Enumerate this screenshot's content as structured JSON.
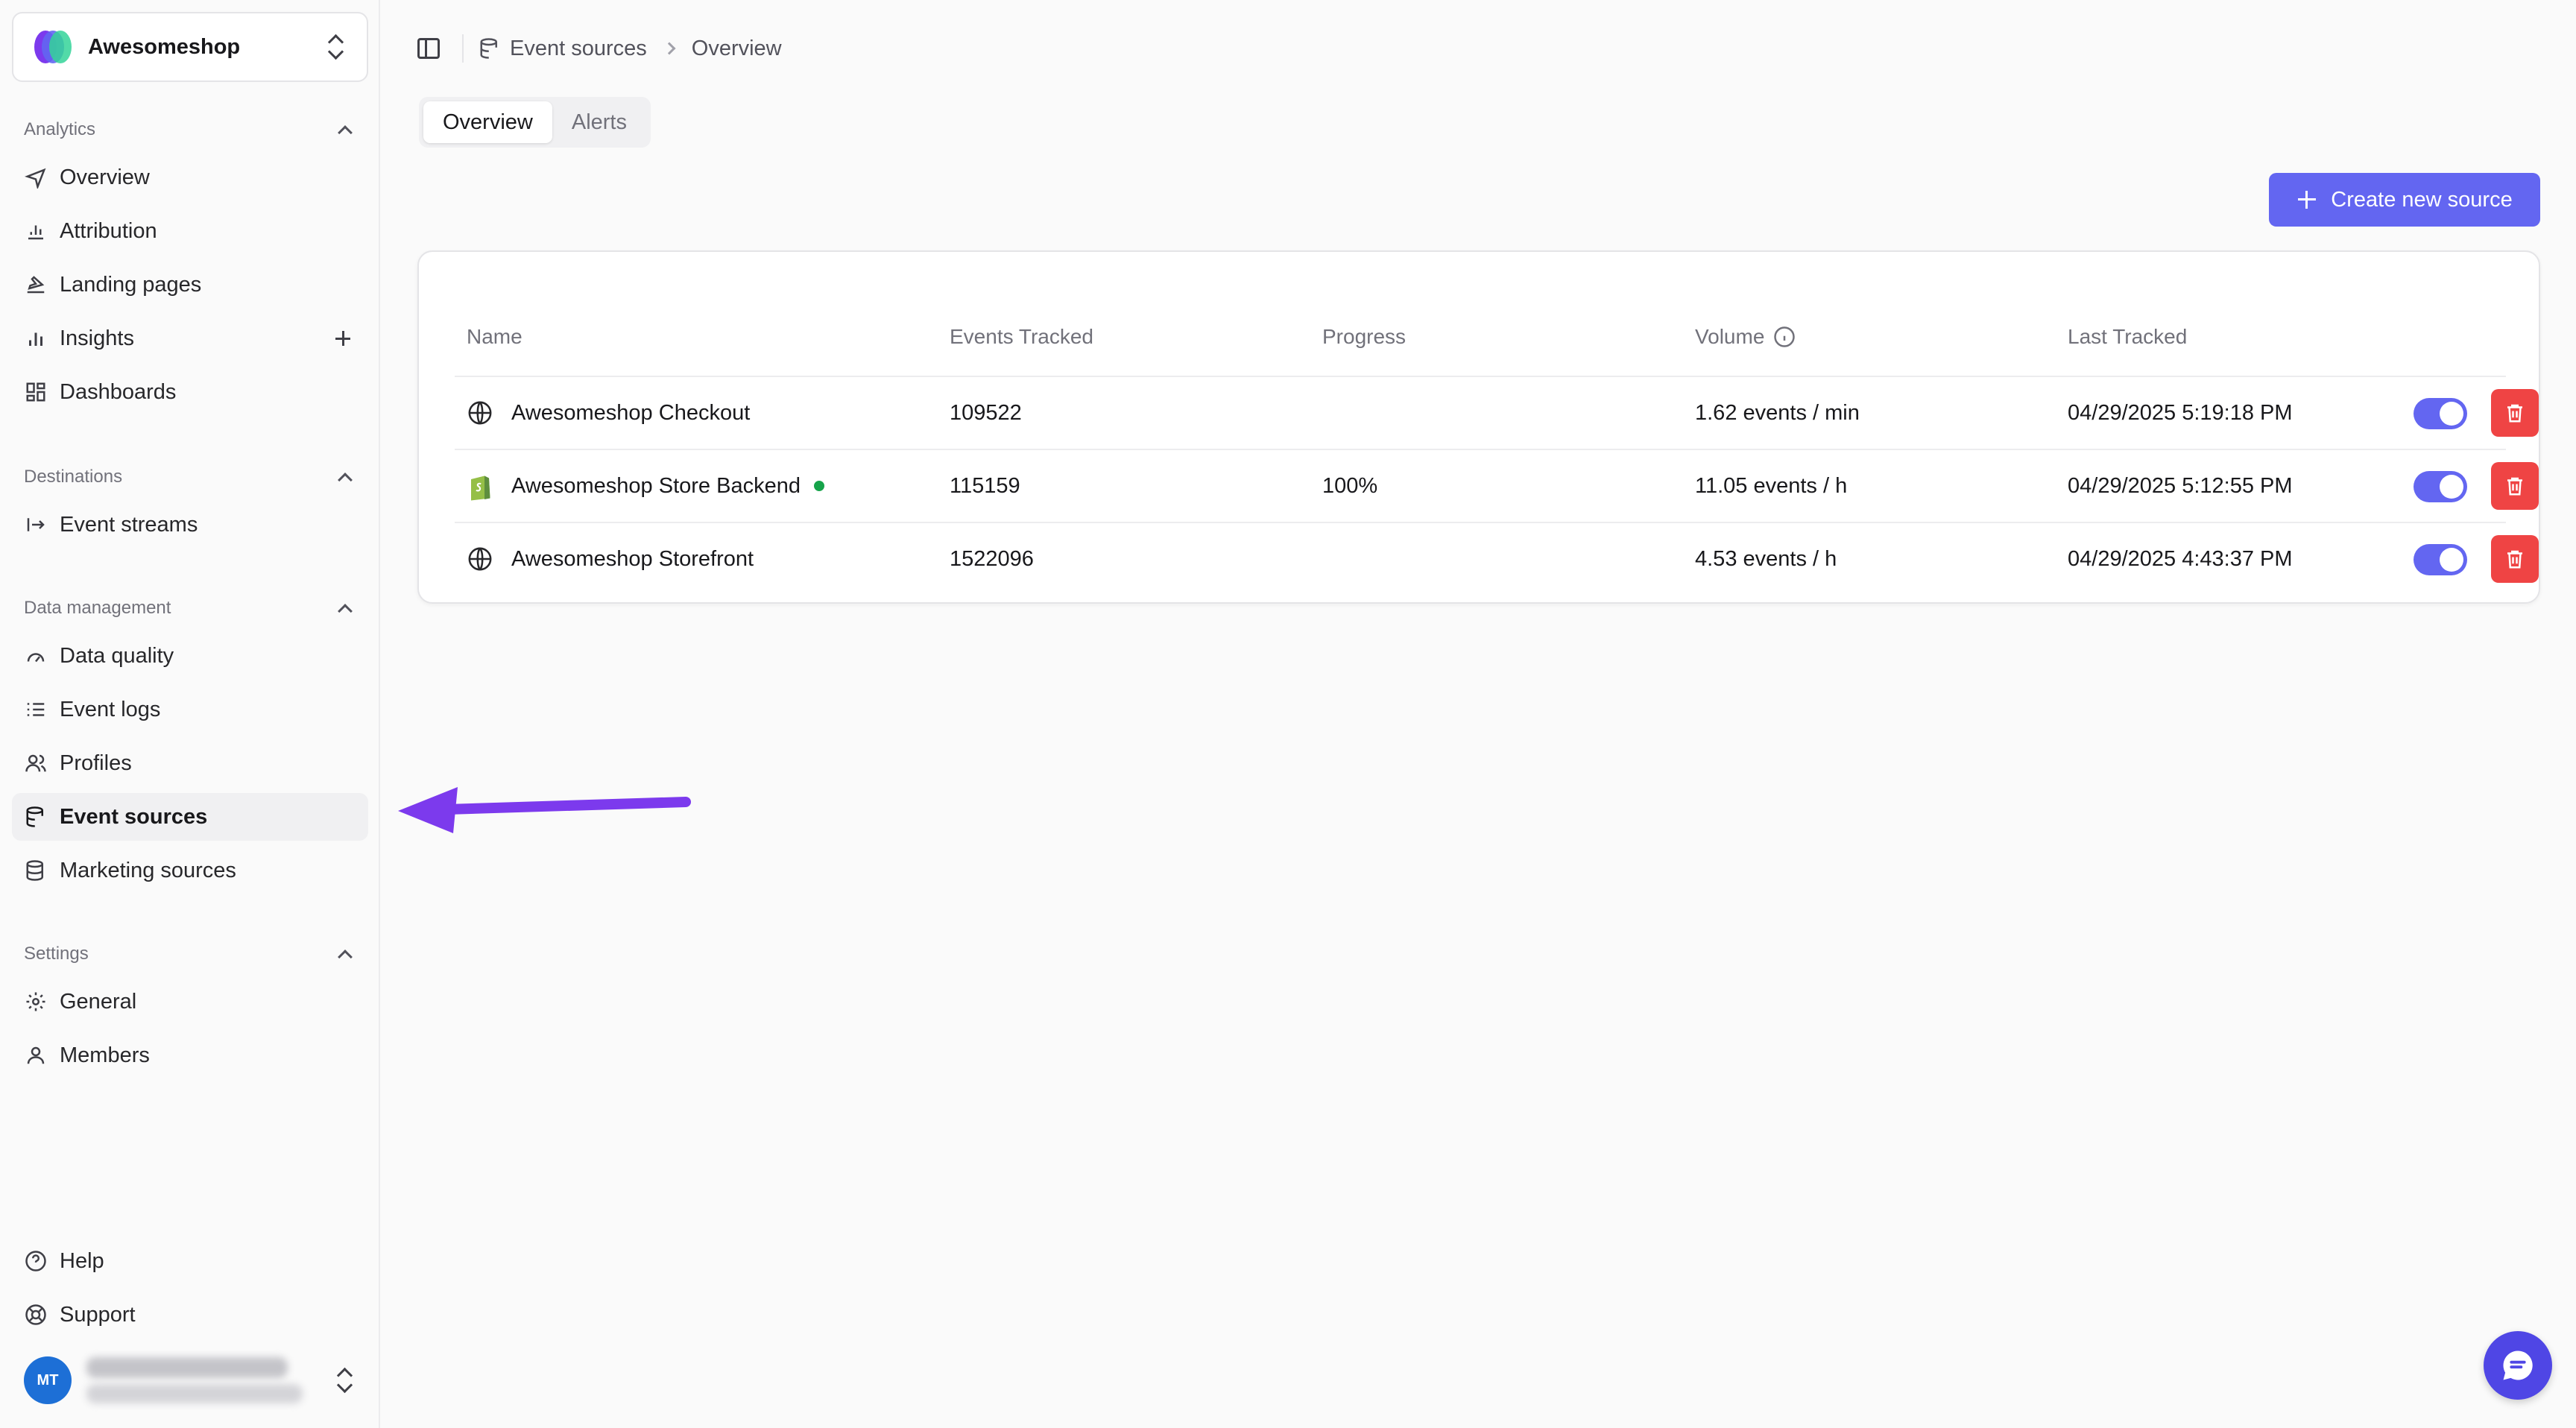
{
  "org": {
    "name": "Awesomeshop"
  },
  "sidebar": {
    "sections": [
      {
        "title": "Analytics",
        "items": [
          {
            "label": "Overview",
            "icon": "compass-icon"
          },
          {
            "label": "Attribution",
            "icon": "attribution-icon"
          },
          {
            "label": "Landing pages",
            "icon": "landing-icon"
          },
          {
            "label": "Insights",
            "icon": "bar-chart-icon"
          },
          {
            "label": "Dashboards",
            "icon": "dashboard-icon"
          }
        ]
      },
      {
        "title": "Destinations",
        "items": [
          {
            "label": "Event streams",
            "icon": "stream-icon"
          }
        ]
      },
      {
        "title": "Data management",
        "items": [
          {
            "label": "Data quality",
            "icon": "gauge-icon"
          },
          {
            "label": "Event logs",
            "icon": "list-icon"
          },
          {
            "label": "Profiles",
            "icon": "users-icon"
          },
          {
            "label": "Event sources",
            "icon": "database-icon"
          },
          {
            "label": "Marketing sources",
            "icon": "database-icon"
          }
        ]
      },
      {
        "title": "Settings",
        "items": [
          {
            "label": "General",
            "icon": "gear-icon"
          },
          {
            "label": "Members",
            "icon": "user-icon"
          }
        ]
      }
    ],
    "footer": [
      {
        "label": "Help",
        "icon": "help-icon"
      },
      {
        "label": "Support",
        "icon": "lifebuoy-icon"
      }
    ],
    "user": {
      "initials": "MT"
    }
  },
  "breadcrumb": {
    "section": "Event sources",
    "page": "Overview"
  },
  "tabs": [
    {
      "label": "Overview",
      "active": true
    },
    {
      "label": "Alerts",
      "active": false
    }
  ],
  "create_button": {
    "label": "Create new source"
  },
  "table": {
    "columns": {
      "name": "Name",
      "events": "Events Tracked",
      "progress": "Progress",
      "volume": "Volume",
      "last": "Last Tracked"
    },
    "rows": [
      {
        "name": "Awesomeshop Checkout",
        "icon": "globe-icon",
        "events": "109522",
        "progress": "",
        "volume": "1.62 events / min",
        "last": "04/29/2025 5:19:18 PM",
        "enabled": true
      },
      {
        "name": "Awesomeshop Store Backend",
        "icon": "shopify-icon",
        "status_color": "#16a34a",
        "events": "115159",
        "progress": "100%",
        "volume": "11.05 events / h",
        "last": "04/29/2025 5:12:55 PM",
        "enabled": true
      },
      {
        "name": "Awesomeshop Storefront",
        "icon": "globe-icon",
        "events": "1522096",
        "progress": "",
        "volume": "4.53 events / h",
        "last": "04/29/2025 4:43:37 PM",
        "enabled": true
      }
    ]
  },
  "colors": {
    "accent": "#6366f1",
    "danger": "#ef4444",
    "annotation_arrow": "#7c3aed"
  }
}
